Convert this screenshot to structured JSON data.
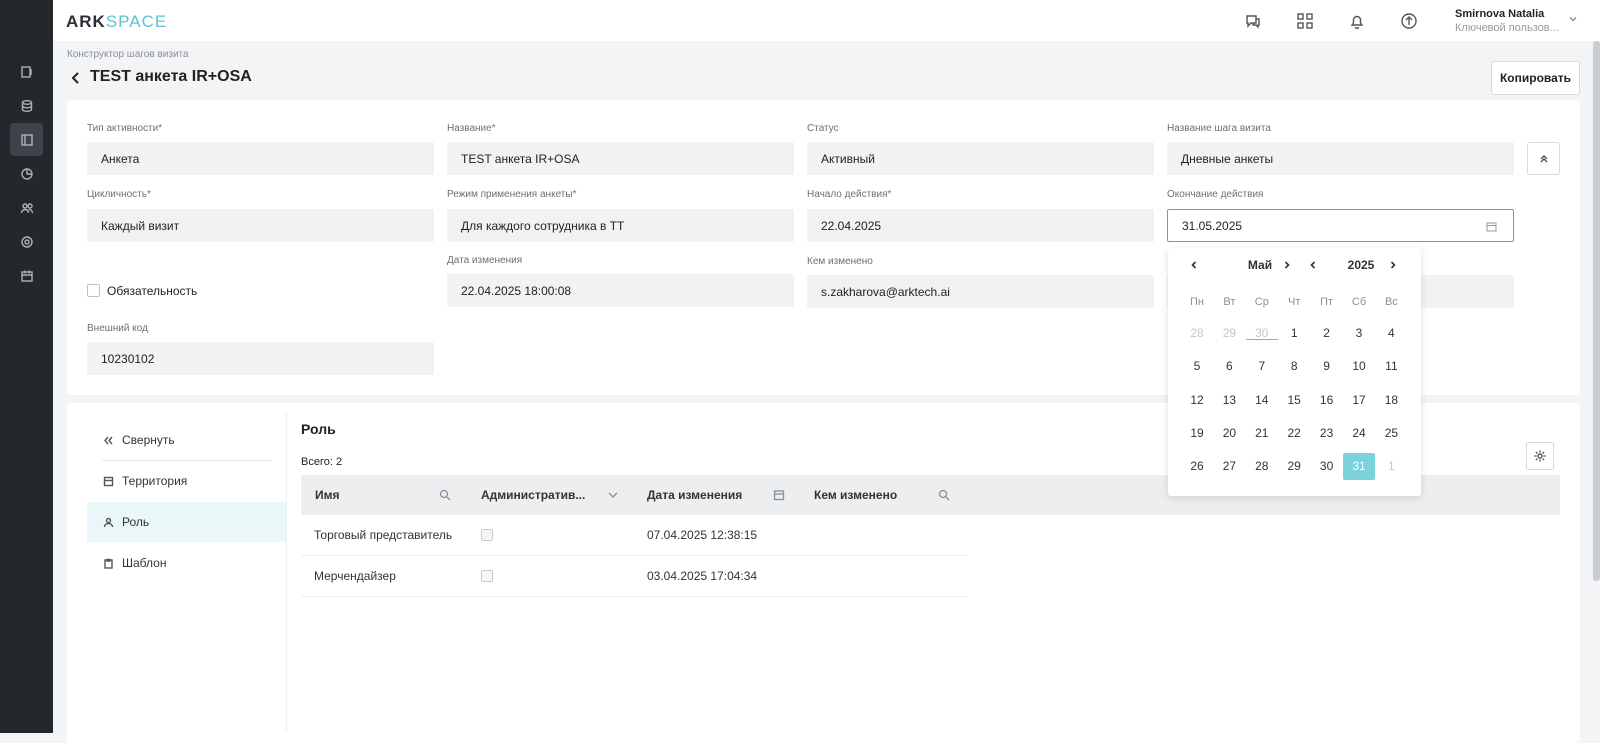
{
  "app": {
    "logo_ark": "ARK",
    "logo_space": "SPACE"
  },
  "user": {
    "name": "Smirnova Natalia",
    "role": "Ключевой пользов..."
  },
  "breadcrumb": "Конструктор шагов визита",
  "page_title": "TEST анкета IR+OSA",
  "copy_button": "Копировать",
  "form": {
    "activity_type": {
      "label": "Тип активности*",
      "value": "Анкета"
    },
    "name": {
      "label": "Название*",
      "value": "TEST анкета IR+OSA"
    },
    "status": {
      "label": "Статус",
      "value": "Активный"
    },
    "step_name": {
      "label": "Название шага визита",
      "value": "Дневные анкеты"
    },
    "cyclicity": {
      "label": "Цикличность*",
      "value": "Каждый визит"
    },
    "mode": {
      "label": "Режим применения анкеты*",
      "value": "Для каждого сотрудника в ТТ"
    },
    "start": {
      "label": "Начало действия*",
      "value": "22.04.2025"
    },
    "end": {
      "label": "Окончание действия",
      "value": "31.05.2025"
    },
    "mandatory": {
      "label": "Обязательность"
    },
    "changed_date": {
      "label": "Дата изменения",
      "value": "22.04.2025 18:00:08"
    },
    "changed_by": {
      "label": "Кем изменено",
      "value": "s.zakharova@arktech.ai"
    },
    "external_code": {
      "label": "Внешний код",
      "value": "10230102"
    }
  },
  "left_nav": {
    "collapse": "Свернуть",
    "items": [
      "Территория",
      "Роль",
      "Шаблон"
    ]
  },
  "section": {
    "title": "Роль",
    "total": "Всего: 2"
  },
  "table": {
    "headers": [
      "Имя",
      "Административ...",
      "Дата изменения",
      "Кем изменено"
    ],
    "rows": [
      {
        "name": "Торговый представитель",
        "date": "07.04.2025 12:38:15"
      },
      {
        "name": "Мерчендайзер",
        "date": "03.04.2025 17:04:34"
      }
    ]
  },
  "calendar": {
    "month": "Май",
    "year": "2025",
    "weekdays": [
      "Пн",
      "Вт",
      "Ср",
      "Чт",
      "Пт",
      "Сб",
      "Вс"
    ],
    "weeks": [
      [
        "28",
        "29",
        "30",
        "1",
        "2",
        "3",
        "4"
      ],
      [
        "5",
        "6",
        "7",
        "8",
        "9",
        "10",
        "11"
      ],
      [
        "12",
        "13",
        "14",
        "15",
        "16",
        "17",
        "18"
      ],
      [
        "19",
        "20",
        "21",
        "22",
        "23",
        "24",
        "25"
      ],
      [
        "26",
        "27",
        "28",
        "29",
        "30",
        "31",
        "1"
      ]
    ],
    "selected": "31",
    "accent_color": "#7cd2da"
  }
}
